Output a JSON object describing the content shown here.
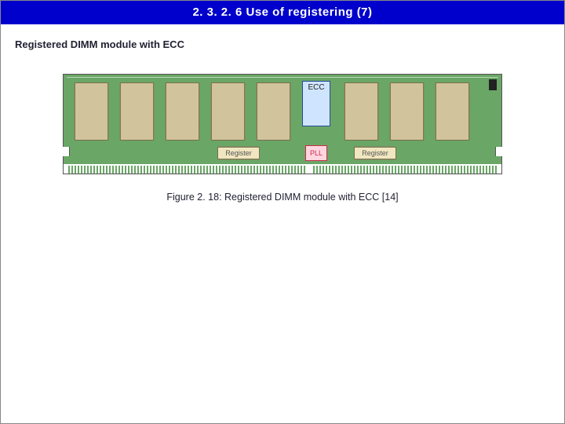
{
  "title": "2. 3. 2. 6  Use of registering (7)",
  "subtitle": "Registered DIMM module with ECC",
  "figure": {
    "ecc_label": "ECC",
    "pll_label": "PLL",
    "register_label": "Register",
    "caption": "Figure 2. 18: Registered DIMM module with ECC [14]"
  }
}
